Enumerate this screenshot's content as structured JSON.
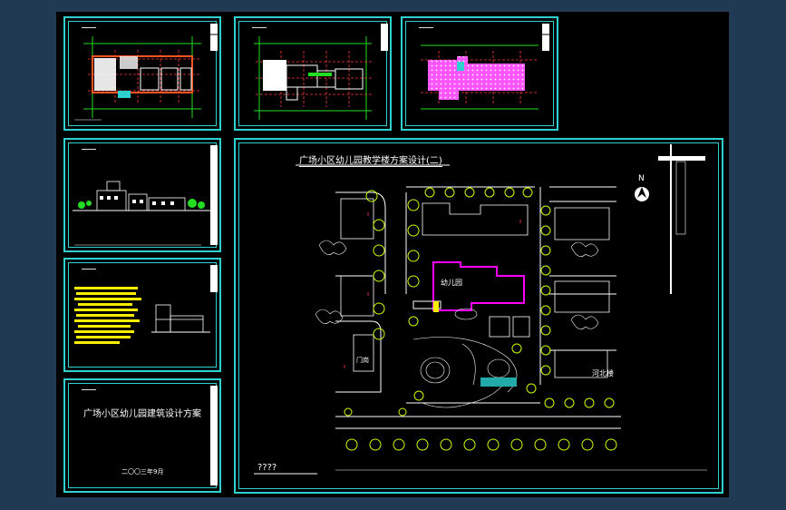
{
  "drawing": {
    "main_title": "广场小区幼儿园教学楼方案设计(二)",
    "kindergarten_label": "幼儿园",
    "left_building_label": "门岗",
    "right_building_label": "河北楼",
    "north_label": "N",
    "scale_text": "????"
  },
  "cover": {
    "title": "广场小区幼儿园建筑设计方案",
    "date": "二〇〇三年9月"
  },
  "colors": {
    "background": "#1f3a52",
    "canvas": "#000000",
    "frame": "#2fd0d0",
    "tree": "#c8ff00",
    "wall": "#ffffff",
    "kindergarten": "#ff00ff",
    "hatch": "#ff55ff",
    "grid_red": "#ff3b3b",
    "grid_green": "#22dd22"
  }
}
